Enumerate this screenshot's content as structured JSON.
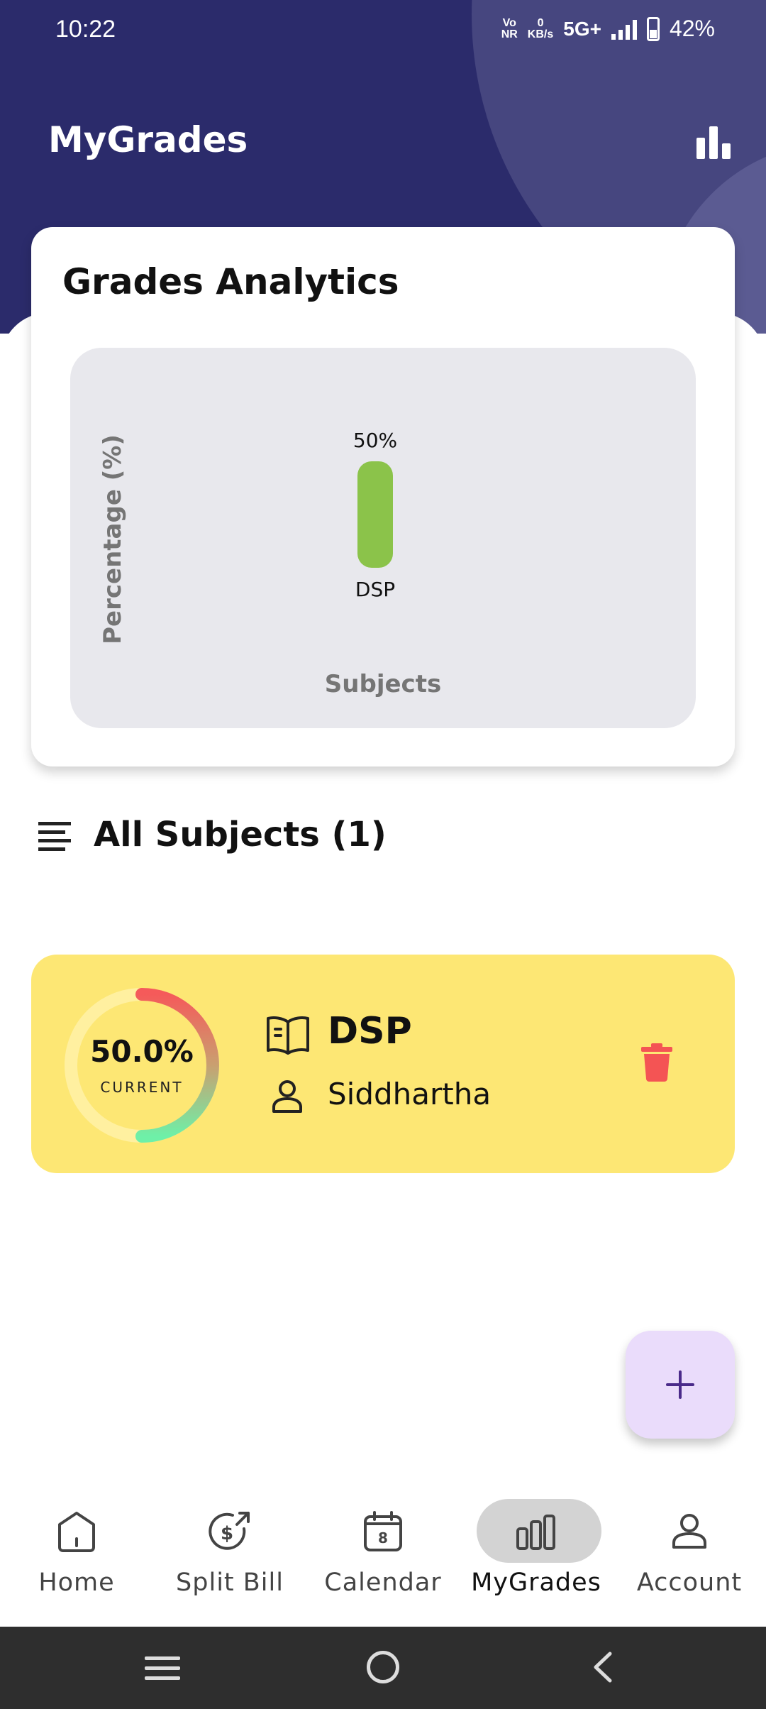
{
  "status_bar": {
    "time": "10:22",
    "vonr": "Vo NR",
    "data_speed_top": "0",
    "data_speed_bottom": "KB/s",
    "network": "5G+",
    "battery": "42%"
  },
  "header": {
    "title": "MyGrades",
    "analytics_icon": "bar-chart-icon"
  },
  "analytics": {
    "title": "Grades Analytics",
    "chart_data": {
      "type": "bar",
      "categories": [
        "DSP"
      ],
      "values": [
        50
      ],
      "value_labels": [
        "50%"
      ],
      "title": "",
      "xlabel": "Subjects",
      "ylabel": "Percentage (%)",
      "ylim": [
        0,
        100
      ],
      "bar_color": "#8bc34a"
    }
  },
  "subjects_section": {
    "heading": "All Subjects (1)",
    "icon": "list-icon"
  },
  "subjects": [
    {
      "percent_label": "50.0%",
      "percent_value": 50,
      "status": "CURRENT",
      "name": "DSP",
      "teacher": "Siddhartha",
      "card_color": "#fde774",
      "delete_color": "#f45454"
    }
  ],
  "fab": {
    "icon": "plus-icon",
    "color": "#eadcfb"
  },
  "bottom_nav": {
    "items": [
      {
        "label": "Home",
        "icon": "home-icon"
      },
      {
        "label": "Split Bill",
        "icon": "split-bill-icon"
      },
      {
        "label": "Calendar",
        "icon": "calendar-icon",
        "badge": "8"
      },
      {
        "label": "MyGrades",
        "icon": "grades-icon",
        "active": true
      },
      {
        "label": "Account",
        "icon": "account-icon"
      }
    ]
  },
  "colors": {
    "header_bg": "#2b2b6b",
    "accent": "#8bc34a"
  }
}
